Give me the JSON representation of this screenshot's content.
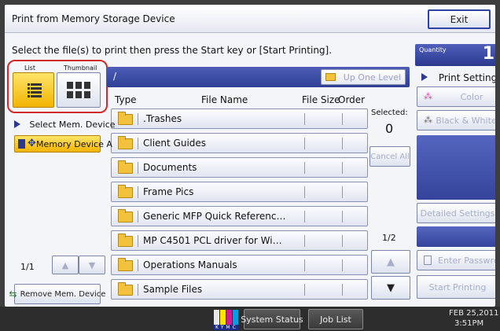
{
  "header": {
    "title": "Print from Memory Storage Device",
    "exit_label": "Exit"
  },
  "instruction": "Select the file(s) to print then press the Start key or [Start Printing].",
  "view_toggle": {
    "list_label": "List",
    "thumbnail_label": "Thumbnail",
    "selected": "list"
  },
  "path": {
    "current": "/",
    "up_one_level_label": "Up One Level"
  },
  "columns": {
    "type": "Type",
    "file_name": "File Name",
    "file_size": "File Size",
    "order": "Order"
  },
  "files": [
    {
      "name": ".Trashes",
      "icon": "folder-icon"
    },
    {
      "name": "Client Guides",
      "icon": "folder-icon"
    },
    {
      "name": "Documents",
      "icon": "folder-icon"
    },
    {
      "name": "Frame Pics",
      "icon": "folder-icon"
    },
    {
      "name": "Generic MFP Quick Referenc…",
      "icon": "folder-icon"
    },
    {
      "name": "MP C4501 PCL driver for Wi…",
      "icon": "folder-icon"
    },
    {
      "name": "Operations Manuals",
      "icon": "folder-icon"
    },
    {
      "name": "Sample Files",
      "icon": "folder-icon"
    }
  ],
  "left_panel": {
    "select_device_label": "Select Mem. Device",
    "device_a_label": "Memory Device A",
    "page_indicator": "1/1",
    "remove_device_label": "Remove Mem. Device"
  },
  "selection": {
    "selected_label": "Selected:",
    "selected_count": "0",
    "cancel_all_label": "Cancel All",
    "page_indicator": "1/2"
  },
  "right_panel": {
    "quantity_label": "Quantity",
    "quantity_value": "1",
    "print_settings_label": "Print Settings",
    "color_label": "Color",
    "black_white_label": "Black & White",
    "detailed_settings_label": "Detailed Settings",
    "enter_password_label": "Enter Passwrd",
    "start_printing_label": "Start Printing"
  },
  "bottom_bar": {
    "system_status_label": "System Status",
    "job_list_label": "Job List",
    "date": "FEB  25,2011",
    "time": "3:51PM"
  },
  "colors": {
    "accent_blue": "#2e3f94",
    "highlight_yellow": "#f2b400",
    "frame_red": "#d22a2a"
  }
}
